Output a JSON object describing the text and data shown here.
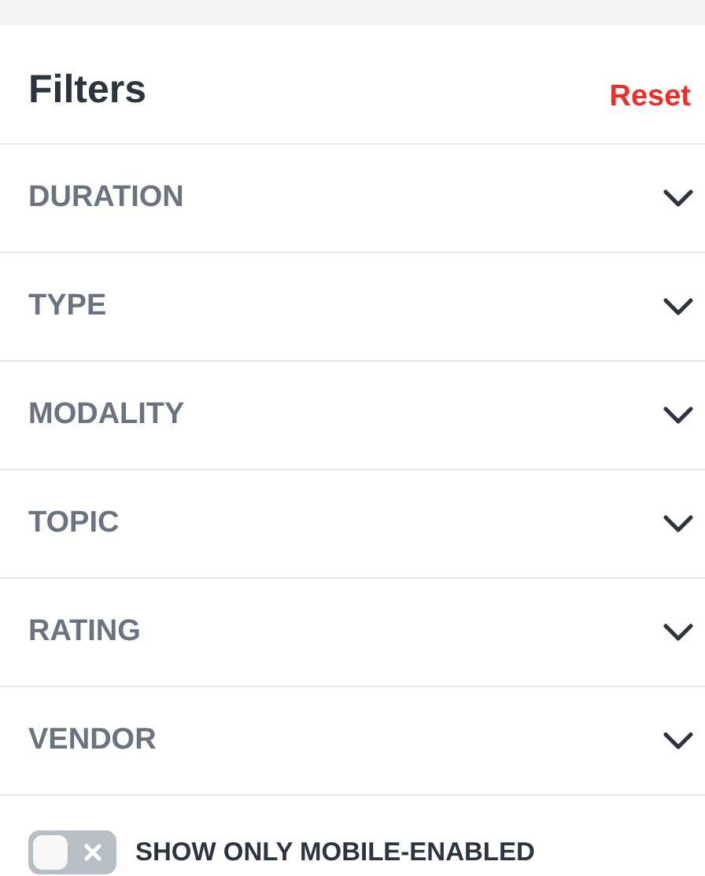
{
  "header": {
    "title": "Filters",
    "reset": "Reset"
  },
  "sections": [
    {
      "label": "DURATION",
      "expanded": false
    },
    {
      "label": "TYPE",
      "expanded": false
    },
    {
      "label": "MODALITY",
      "expanded": false
    },
    {
      "label": "TOPIC",
      "expanded": false
    },
    {
      "label": "RATING",
      "expanded": false
    },
    {
      "label": "VENDOR",
      "expanded": false
    }
  ],
  "mobile_toggle": {
    "label": "SHOW ONLY MOBILE-ENABLED",
    "on": false
  }
}
